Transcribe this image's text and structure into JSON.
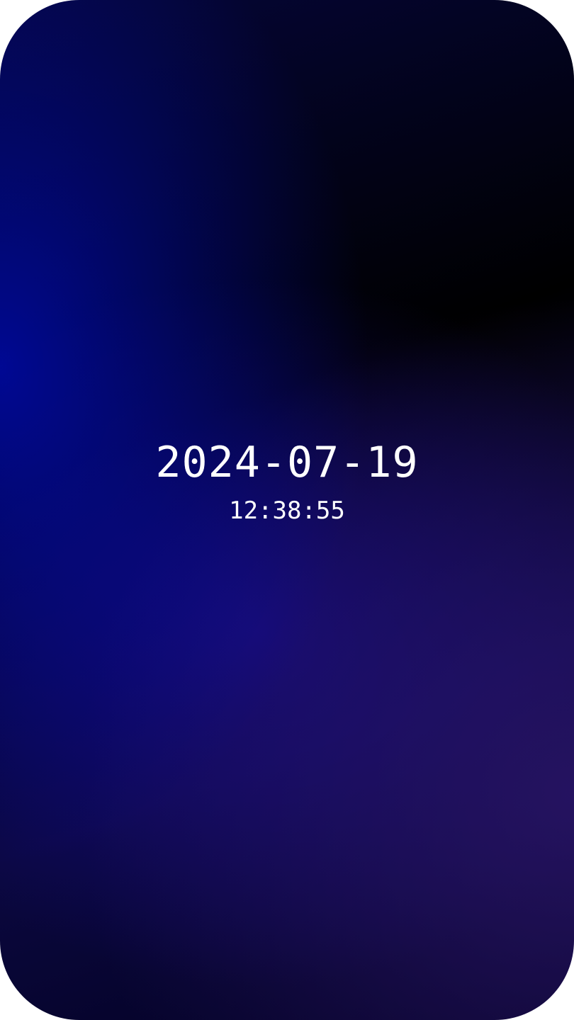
{
  "lock_screen": {
    "date": "2024-07-19",
    "time": "12:38:55"
  },
  "colors": {
    "background_accent": "#0a0aa0",
    "background_dark": "#000000",
    "text": "#ffffff"
  }
}
